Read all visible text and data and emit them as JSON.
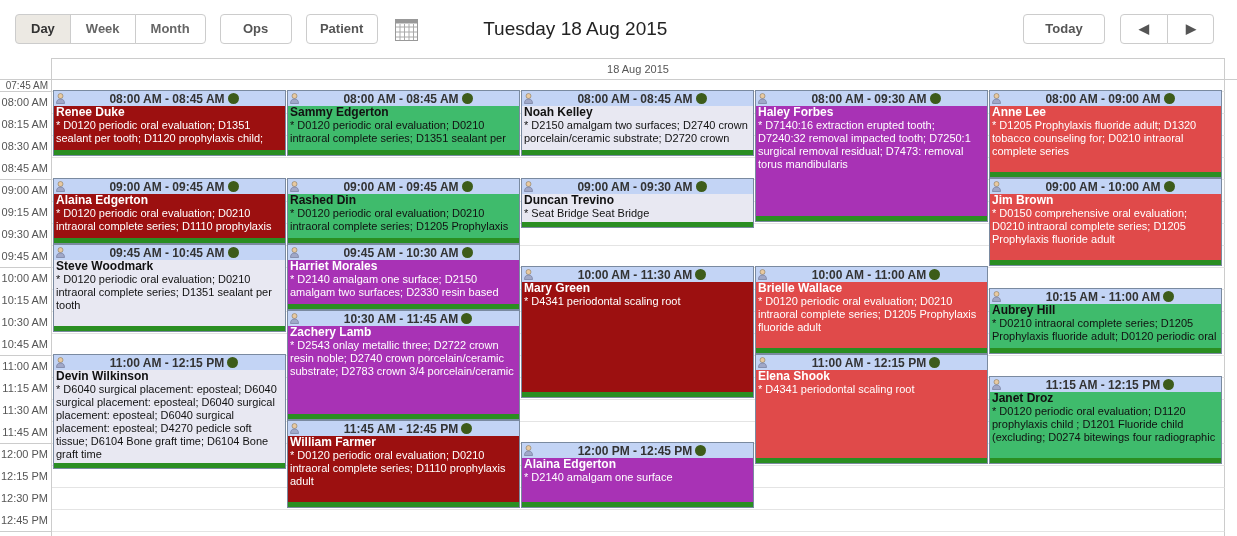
{
  "toolbar": {
    "views": [
      {
        "label": "Day",
        "selected": true
      },
      {
        "label": "Week",
        "selected": false
      },
      {
        "label": "Month",
        "selected": false
      }
    ],
    "ops_button": "Ops",
    "patient_button": "Patient",
    "title": "Tuesday 18 Aug 2015",
    "today_button": "Today",
    "prev_button": "◀",
    "next_button": "▶"
  },
  "day_header": "18 Aug 2015",
  "times": [
    "07:45 AM",
    "08:00 AM",
    "08:15 AM",
    "08:30 AM",
    "08:45 AM",
    "09:00 AM",
    "09:15 AM",
    "09:30 AM",
    "09:45 AM",
    "10:00 AM",
    "10:15 AM",
    "10:30 AM",
    "10:45 AM",
    "11:00 AM",
    "11:15 AM",
    "11:30 AM",
    "11:45 AM",
    "12:00 PM",
    "12:15 PM",
    "12:30 PM",
    "12:45 PM"
  ],
  "columns": [
    {
      "events": [
        {
          "time": "08:00 AM - 08:45 AM",
          "patient": "Renee Duke",
          "procedures": "* D0120 periodic oral evaluation; D1351 sealant per tooth; D1120 prophylaxis child;",
          "color": "#9c1010"
        },
        {
          "time": "09:00 AM - 09:45 AM",
          "patient": "Alaina Edgerton",
          "procedures": "* D0120 periodic oral evaluation; D0210 intraoral complete series; D1110 prophylaxis",
          "color": "#9c1010"
        },
        {
          "time": "09:45 AM - 10:45 AM",
          "patient": "Steve Woodmark",
          "procedures": "* D0120 periodic oral evaluation; D0210 intraoral complete series; D1351 sealant per tooth",
          "color": "#e8e8f2"
        },
        {
          "time": "11:00 AM - 12:15 PM",
          "patient": "Devin Wilkinson",
          "procedures": "* D6040 surgical placement: eposteal; D6040 surgical placement: eposteal; D6040 surgical placement: eposteal; D6040 surgical placement: eposteal; D4270 pedicle soft tissue; D6104 Bone graft time; D6104 Bone graft time",
          "color": "#e8e8f2"
        }
      ]
    },
    {
      "events": [
        {
          "time": "08:00 AM - 08:45 AM",
          "patient": "Sammy Edgerton",
          "procedures": "* D0120 periodic oral evaluation; D0210 intraoral complete series; D1351 sealant per",
          "color": "#3fbb6c"
        },
        {
          "time": "09:00 AM - 09:45 AM",
          "patient": "Rashed Din",
          "procedures": "* D0120 periodic oral evaluation; D0210 intraoral complete series; D1205 Prophylaxis",
          "color": "#3fbb6c"
        },
        {
          "time": "09:45 AM - 10:30 AM",
          "patient": "Harriet Morales",
          "procedures": "* D2140 amalgam one surface; D2150 amalgam two surfaces; D2330 resin based",
          "color": "#a832b5"
        },
        {
          "time": "10:30 AM - 11:45 AM",
          "patient": "Zachery Lamb",
          "procedures": "* D2543 onlay metallic three; D2722 crown resin noble; D2740 crown porcelain/ceramic substrate; D2783 crown 3/4 porcelain/ceramic",
          "color": "#a832b5"
        },
        {
          "time": "11:45 AM - 12:45 PM",
          "patient": "William Farmer",
          "procedures": "* D0120 periodic oral evaluation; D0210 intraoral complete series; D1110 prophylaxis adult",
          "color": "#9c1010"
        }
      ]
    },
    {
      "events": [
        {
          "time": "08:00 AM - 08:45 AM",
          "patient": "Noah Kelley",
          "procedures": "* D2150 amalgam two surfaces; D2740 crown porcelain/ceramic substrate; D2720 crown",
          "color": "#e8e8f2"
        },
        {
          "time": "09:00 AM - 09:30 AM",
          "patient": "Duncan Trevino",
          "procedures": "* Seat Bridge Seat Bridge",
          "color": "#e8e8f2"
        },
        {
          "time": "10:00 AM - 11:30 AM",
          "patient": "Mary Green",
          "procedures": "* D4341 periodontal scaling root",
          "color": "#9c1010"
        },
        {
          "time": "12:00 PM - 12:45 PM",
          "patient": "Alaina Edgerton",
          "procedures": "* D2140 amalgam one surface",
          "color": "#a832b5"
        }
      ]
    },
    {
      "events": [
        {
          "time": "08:00 AM - 09:30 AM",
          "patient": "Haley Forbes",
          "procedures": "* D7140:16 extraction erupted tooth; D7240:32 removal impacted tooth; D7250:1 surgical removal residual; D7473: removal torus mandibularis",
          "color": "#a832b5"
        },
        {
          "time": "10:00 AM - 11:00 AM",
          "patient": "Brielle Wallace",
          "procedures": "* D0120 periodic oral evaluation; D0210 intraoral complete series; D1205 Prophylaxis fluoride adult",
          "color": "#e04a4a"
        },
        {
          "time": "11:00 AM - 12:15 PM",
          "patient": "Elena Shook",
          "procedures": "* D4341 periodontal scaling root",
          "color": "#e04a4a"
        }
      ]
    },
    {
      "events": [
        {
          "time": "08:00 AM - 09:00 AM",
          "patient": "Anne Lee",
          "procedures": "* D1205 Prophylaxis fluoride adult; D1320 tobacco counseling for; D0210 intraoral complete series",
          "color": "#e04a4a"
        },
        {
          "time": "09:00 AM - 10:00 AM",
          "patient": "Jim Brown",
          "procedures": "* D0150 comprehensive oral evaluation; D0210 intraoral complete series; D1205 Prophylaxis fluoride adult",
          "color": "#e04a4a"
        },
        {
          "time": "10:15 AM - 11:00 AM",
          "patient": "Aubrey Hill",
          "procedures": "* D0210 intraoral complete series; D1205 Prophylaxis fluoride adult; D0120 periodic oral",
          "color": "#3fbb6c"
        },
        {
          "time": "11:15 AM - 12:15 PM",
          "patient": "Janet Droz",
          "procedures": "* D0120 periodic oral evaluation; D1120 prophylaxis child ; D1201 Fluoride child (excluding; D0274 bitewings four radiographic",
          "color": "#3fbb6c"
        }
      ]
    }
  ]
}
